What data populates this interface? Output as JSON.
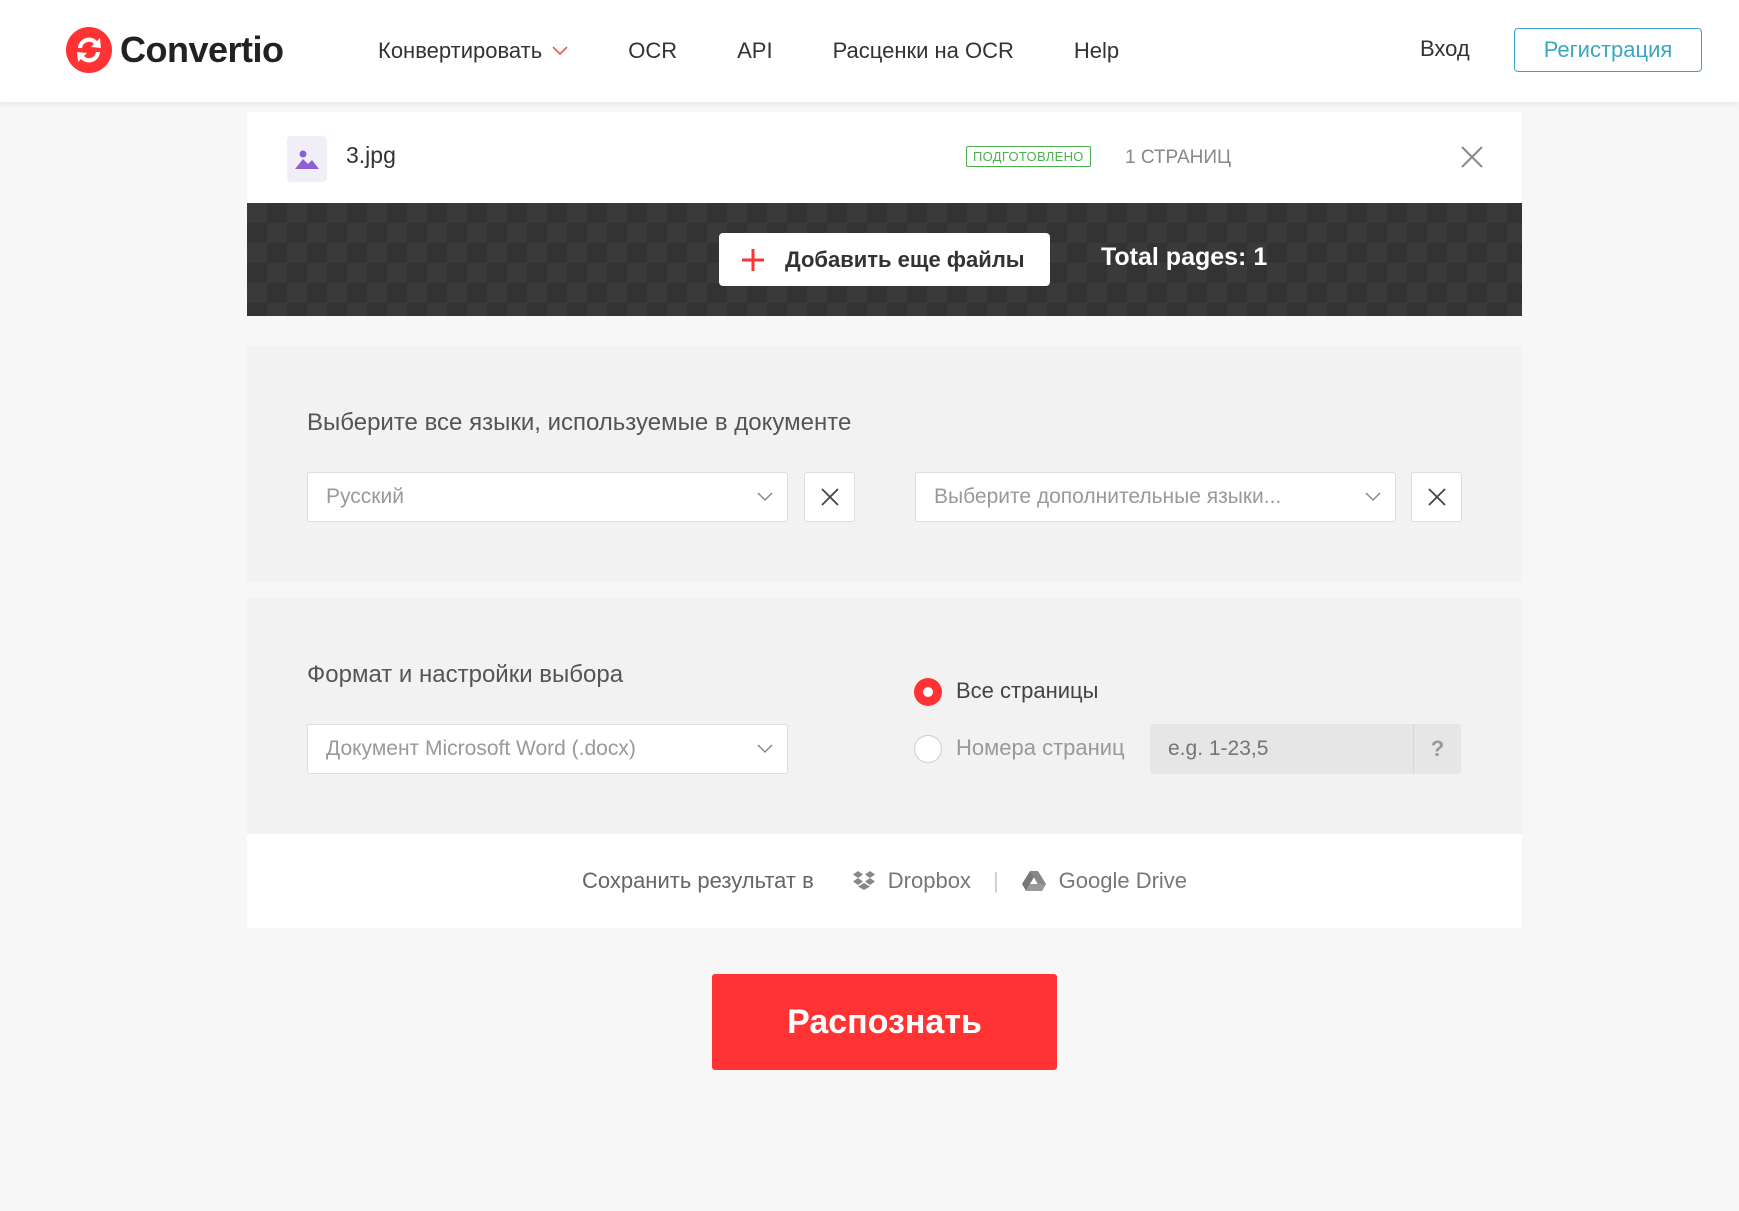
{
  "brand": {
    "name": "Convertio"
  },
  "nav": {
    "items": [
      {
        "label": "Конвертировать"
      },
      {
        "label": "OCR"
      },
      {
        "label": "API"
      },
      {
        "label": "Расценки на OCR"
      },
      {
        "label": "Help"
      }
    ],
    "login": "Вход",
    "register": "Регистрация"
  },
  "file": {
    "name": "3.jpg",
    "status": "ПОДГОТОВЛЕНО",
    "pages": "1 СТРАНИЦ"
  },
  "toolbar": {
    "add_files": "Добавить еще файлы",
    "total_pages": "Total pages: 1"
  },
  "languages": {
    "title": "Выберите все языки, используемые в документе",
    "primary": "Русский",
    "additional_placeholder": "Выберите дополнительные языки..."
  },
  "format": {
    "title": "Формат и настройки выбора",
    "selected": "Документ Microsoft Word (.docx)",
    "all_pages_label": "Все страницы",
    "page_numbers_label": "Номера страниц",
    "page_range_placeholder": "e.g. 1-23,5",
    "help": "?",
    "all_pages_selected": true
  },
  "save": {
    "label": "Сохранить результат в",
    "dropbox": "Dropbox",
    "separator": "|",
    "google_drive": "Google Drive"
  },
  "action": {
    "recognize": "Распознать"
  },
  "colors": {
    "accent": "#ff3333",
    "link": "#3aa7c2",
    "success": "#4caf50",
    "dark": "#3a3a3a"
  }
}
